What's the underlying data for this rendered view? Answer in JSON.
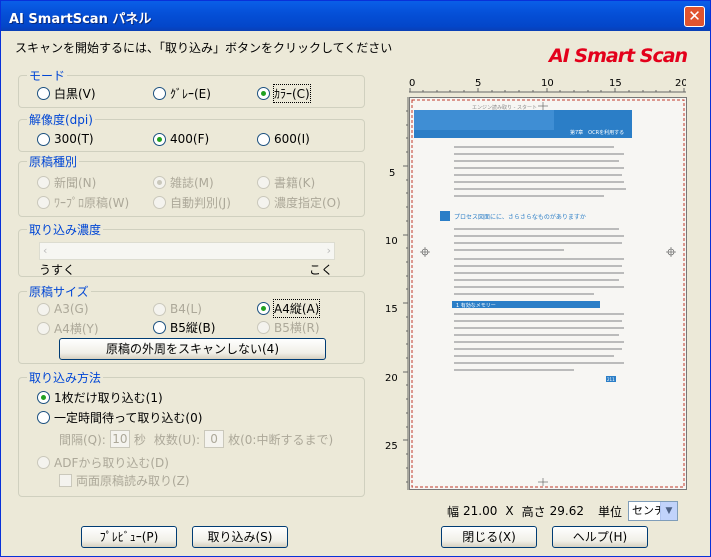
{
  "window": {
    "title": "AI SmartScan パネル",
    "close_glyph": "✕"
  },
  "instruction": "スキャンを開始するには、「取り込み」ボタンをクリックしてください",
  "logo": {
    "text": "AI Smart Scan",
    "color": "#e3001b"
  },
  "mode": {
    "label": "モード",
    "options": [
      {
        "label": "白黒(V)",
        "checked": false
      },
      {
        "label": "ｸﾞﾚｰ(E)",
        "checked": false
      },
      {
        "label": "ｶﾗｰ(C)",
        "checked": true
      }
    ]
  },
  "resolution": {
    "label": "解像度(dpi)",
    "options": [
      {
        "label": "300(T)",
        "checked": false
      },
      {
        "label": "400(F)",
        "checked": true
      },
      {
        "label": "600(I)",
        "checked": false
      }
    ]
  },
  "doc_type": {
    "label": "原稿種別",
    "options": [
      {
        "label": "新聞(N)",
        "checked": false
      },
      {
        "label": "雑誌(M)",
        "checked": true
      },
      {
        "label": "書籍(K)",
        "checked": false
      },
      {
        "label": "ﾜｰﾌﾟﾛ原稿(W)",
        "checked": false
      },
      {
        "label": "自動判別(J)",
        "checked": false
      },
      {
        "label": "濃度指定(O)",
        "checked": false
      }
    ]
  },
  "density": {
    "label": "取り込み濃度",
    "min_label": "うすく",
    "max_label": "こく"
  },
  "paper_size": {
    "label": "原稿サイズ",
    "options": [
      {
        "label": "A3(G)",
        "checked": false,
        "enabled": false
      },
      {
        "label": "B4(L)",
        "checked": false,
        "enabled": false
      },
      {
        "label": "A4縦(A)",
        "checked": true,
        "enabled": true
      },
      {
        "label": "A4横(Y)",
        "checked": false,
        "enabled": false
      },
      {
        "label": "B5縦(B)",
        "checked": false,
        "enabled": true
      },
      {
        "label": "B5横(R)",
        "checked": false,
        "enabled": false
      }
    ],
    "outer_button": "原稿の外周をスキャンしない(4)"
  },
  "capture_method": {
    "label": "取り込み方法",
    "once": "1枚だけ取り込む(1)",
    "timed": "一定時間待って取り込む(0)",
    "interval_label": "間隔(Q):",
    "interval_value": "10",
    "interval_unit": "秒",
    "count_label": "枚数(U):",
    "count_value": "0",
    "count_unit": "枚(0:中断するまで)",
    "adf": "ADFから取り込む(D)",
    "duplex": "両面原稿読み取り(Z)"
  },
  "ruler": {
    "top_ticks": [
      "0",
      "5",
      "10",
      "15",
      "20"
    ],
    "left_ticks": [
      "5",
      "10",
      "15",
      "20",
      "25"
    ]
  },
  "preview": {
    "header_left": "エンジン読み取り - スタート",
    "header_right": "第7章　OCRを利用する",
    "heading": "プロセス図面にに、さらさらなものがありますか",
    "section": "1 有効なメモリー",
    "page_number": "211"
  },
  "size_readout": {
    "width_label": "幅",
    "width_value": "21.00",
    "times": "X",
    "height_label": "高さ",
    "height_value": "29.62",
    "unit_label": "単位",
    "unit_value": "センチ"
  },
  "buttons": {
    "preview": "ﾌﾟﾚﾋﾞｭｰ(P)",
    "scan": "取り込み(S)",
    "close": "閉じる(X)",
    "help": "ヘルプ(H)"
  }
}
